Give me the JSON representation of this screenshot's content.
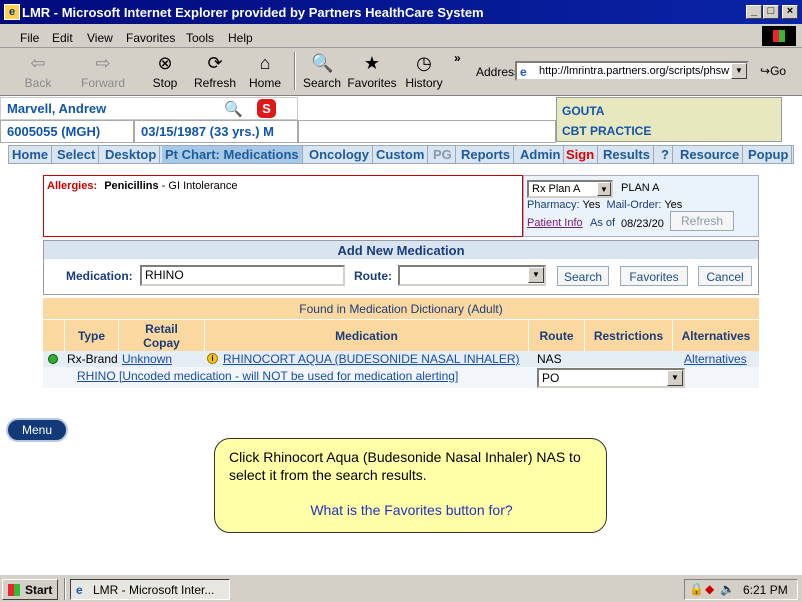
{
  "window": {
    "title": "LMR - Microsoft Internet Explorer provided by Partners HealthCare System"
  },
  "menu": [
    "File",
    "Edit",
    "View",
    "Favorites",
    "Tools",
    "Help"
  ],
  "toolbar": {
    "back": "Back",
    "forward": "Forward",
    "stop": "Stop",
    "refresh": "Refresh",
    "home": "Home",
    "search": "Search",
    "favorites": "Favorites",
    "history": "History",
    "more": "»"
  },
  "address": {
    "label": "Address",
    "url": "http://lmrintra.partners.org/scripts/phsw",
    "go": "Go"
  },
  "patient": {
    "name": "Marvell, Andrew",
    "mrn": "6005055 (MGH)",
    "dob": "03/15/1987  (33 yrs.) M",
    "practice_line1": "GOUTA",
    "practice_line2": "CBT PRACTICE",
    "s_badge": "S"
  },
  "nav": [
    "Home",
    "Select",
    "Desktop",
    "Pt Chart: Medications",
    "Oncology",
    "Custom",
    "PG",
    "Reports",
    "Admin",
    "Sign",
    "Results",
    "?",
    "Resource",
    "Popup"
  ],
  "allergies": {
    "label": "Allergies:",
    "drug": "Penicillins",
    "reaction": " - GI Intolerance"
  },
  "plan": {
    "select": "Rx Plan A",
    "name": "PLAN A",
    "pharmacy_label": "Pharmacy:",
    "pharmacy_val": "Yes",
    "mail_label": "Mail-Order:",
    "mail_val": "Yes",
    "patient_info": "Patient Info",
    "as_of_label": "As of",
    "as_of_date": "08/23/20",
    "refresh": "Refresh"
  },
  "add_med": {
    "title": "Add New Medication",
    "med_label": "Medication:",
    "med_value": "RHINO",
    "route_label": "Route:",
    "route_value": "",
    "search": "Search",
    "favorites": "Favorites",
    "cancel": "Cancel"
  },
  "dictionary": {
    "title": "Found in Medication Dictionary (Adult)",
    "headers": [
      "Type",
      "Retail\nCopay",
      "Medication",
      "Route",
      "Restrictions",
      "Alternatives"
    ],
    "row1": {
      "type": "Rx-Brand",
      "copay": "Unknown",
      "medication": "RHINOCORT AQUA (BUDESONIDE NASAL INHALER)",
      "route": "NAS",
      "alternatives": "Alternatives"
    },
    "row2": {
      "text": "RHINO [Uncoded medication - will NOT be used for medication alerting]",
      "route": "PO"
    }
  },
  "menu_button": "Menu",
  "tip": {
    "instruction": "Click Rhinocort Aqua (Budesonide Nasal Inhaler) NAS to select it from the search results.",
    "question": "What is the Favorites button for?"
  },
  "taskbar": {
    "start": "Start",
    "task": "LMR - Microsoft Inter...",
    "time": "6:21 PM"
  }
}
